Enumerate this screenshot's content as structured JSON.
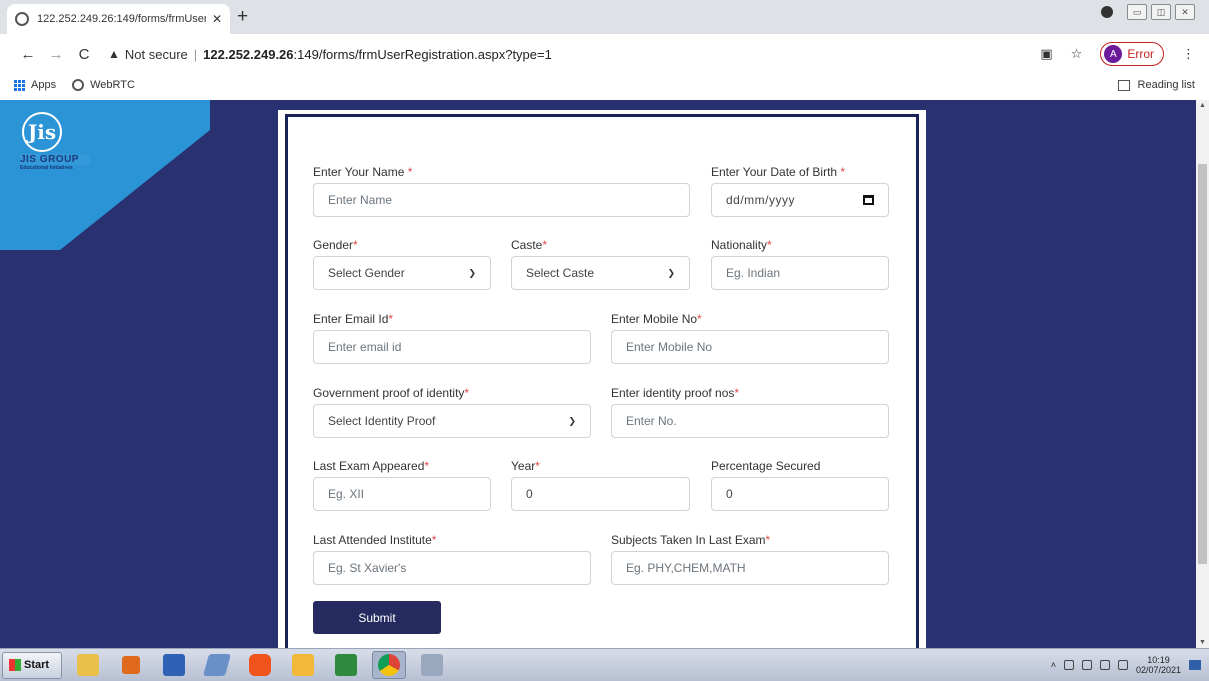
{
  "browser": {
    "tab_title": "122.252.249.26:149/forms/frmUser",
    "tab_close": "✕",
    "new_tab": "+",
    "not_secure": "Not secure",
    "url_host": "122.252.249.26",
    "url_rest": ":149/forms/frmUserRegistration.aspx?type=1",
    "profile_initial": "A",
    "profile_status": "Error",
    "bookmarks": [
      "Apps",
      "WebRTC"
    ],
    "reading_list": "Reading list"
  },
  "logo": {
    "mark": "Jis",
    "group": "JIS GROUP",
    "tagline": "Educational Initiatives"
  },
  "form": {
    "name_label": "Enter Your Name",
    "name_placeholder": "Enter Name",
    "dob_label": "Enter Your Date of Birth",
    "dob_value": "dd/mm/yyyy",
    "gender_label": "Gender",
    "gender_value": "Select Gender",
    "caste_label": "Caste",
    "caste_value": "Select Caste",
    "nationality_label": "Nationality",
    "nationality_placeholder": "Eg. Indian",
    "email_label": "Enter Email Id",
    "email_placeholder": "Enter email id",
    "mobile_label": "Enter Mobile No",
    "mobile_placeholder": "Enter Mobile No",
    "gov_proof_label": "Government proof of identity",
    "gov_proof_value": "Select Identity Proof",
    "proof_nos_label": "Enter identity proof nos",
    "proof_nos_placeholder": "Enter No.",
    "last_exam_label": "Last Exam Appeared",
    "last_exam_placeholder": "Eg. XII",
    "year_label": "Year",
    "year_value": "0",
    "percentage_label": "Percentage Secured",
    "percentage_value": "0",
    "institute_label": "Last Attended Institute",
    "institute_placeholder": "Eg. St Xavier's",
    "subjects_label": "Subjects Taken In Last Exam",
    "subjects_placeholder": "Eg. PHY,CHEM,MATH",
    "required_mark": "*",
    "submit": "Submit"
  },
  "taskbar": {
    "start": "Start",
    "time": "10:19",
    "date": "02/07/2021"
  },
  "colors": {
    "page_bg": "#2a3171",
    "accent_band": "#2a94d6",
    "button": "#252b5e",
    "required": "#e04848"
  }
}
